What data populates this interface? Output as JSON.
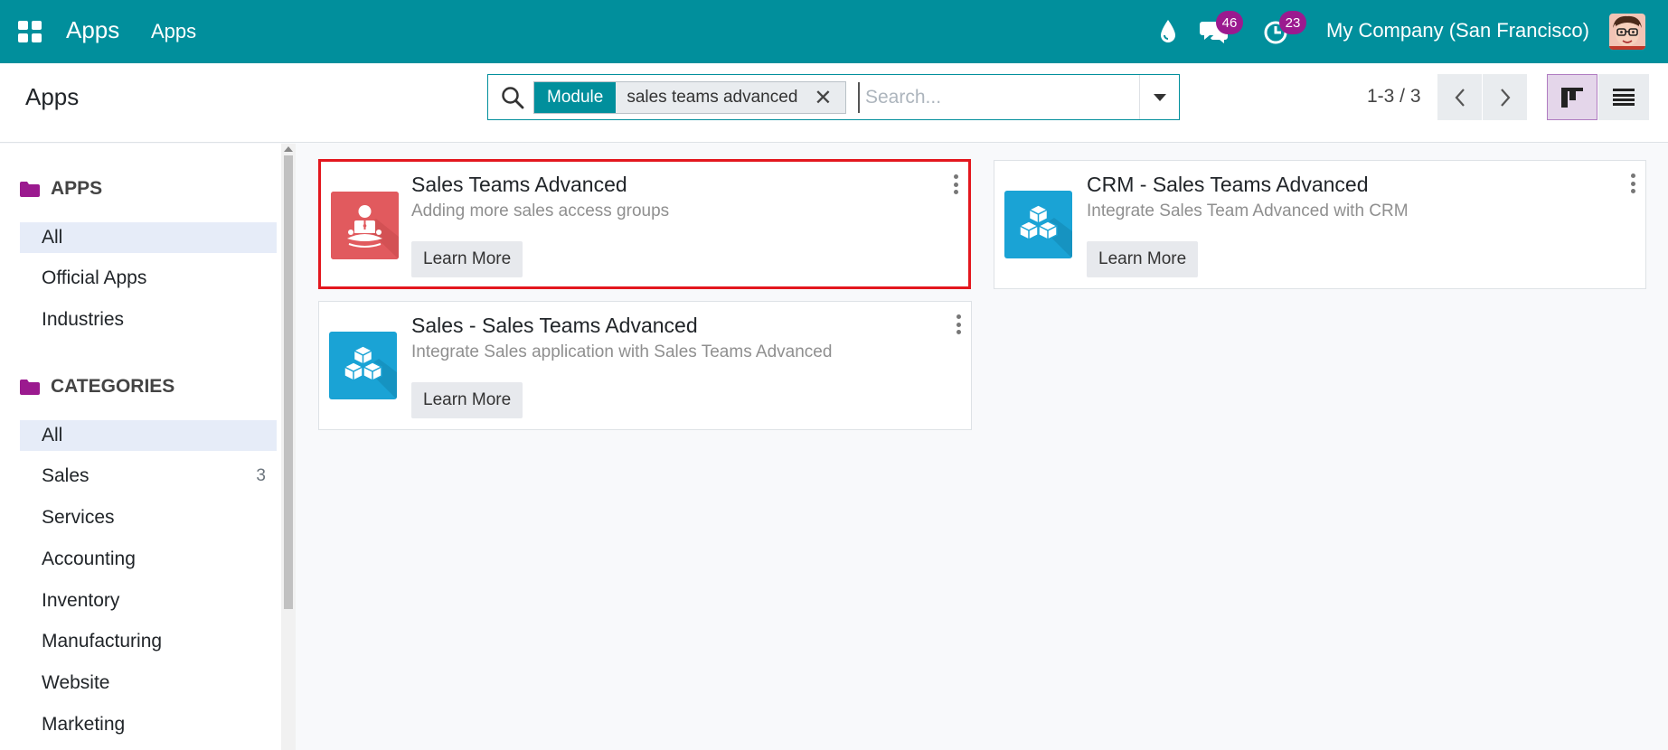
{
  "navbar": {
    "brand": "Apps",
    "menu_item": "Apps",
    "messages_count": "46",
    "activities_count": "23",
    "company": "My Company (San Francisco)"
  },
  "control_panel": {
    "title": "Apps",
    "facet_type": "Module",
    "facet_value": "sales teams advanced",
    "search_placeholder": "Search...",
    "pager": "1-3 / 3"
  },
  "sidebar": {
    "apps_heading": "APPS",
    "apps_items": [
      {
        "label": "All",
        "active": true
      },
      {
        "label": "Official Apps",
        "active": false
      },
      {
        "label": "Industries",
        "active": false
      }
    ],
    "categories_heading": "CATEGORIES",
    "category_items": [
      {
        "label": "All",
        "count": "",
        "active": true
      },
      {
        "label": "Sales",
        "count": "3",
        "active": false
      },
      {
        "label": "Services",
        "count": "",
        "active": false
      },
      {
        "label": "Accounting",
        "count": "",
        "active": false
      },
      {
        "label": "Inventory",
        "count": "",
        "active": false
      },
      {
        "label": "Manufacturing",
        "count": "",
        "active": false
      },
      {
        "label": "Website",
        "count": "",
        "active": false
      },
      {
        "label": "Marketing",
        "count": "",
        "active": false
      }
    ]
  },
  "cards": [
    {
      "title": "Sales Teams Advanced",
      "subtitle": "Adding more sales access groups",
      "button": "Learn More",
      "icon": "meditation-person-icon",
      "color": "#e15a5e"
    },
    {
      "title": "CRM - Sales Teams Advanced",
      "subtitle": "Integrate Sales Team Advanced with CRM",
      "button": "Learn More",
      "icon": "cubes-icon",
      "color": "#1aa3d5"
    },
    {
      "title": "Sales - Sales Teams Advanced",
      "subtitle": "Integrate Sales application with Sales Teams Advanced",
      "button": "Learn More",
      "icon": "cubes-icon",
      "color": "#1aa3d5"
    }
  ],
  "colors": {
    "brand": "#018f9c",
    "badge": "#9b1a8f",
    "folder": "#9b1a8f",
    "selection": "#e3171e"
  }
}
